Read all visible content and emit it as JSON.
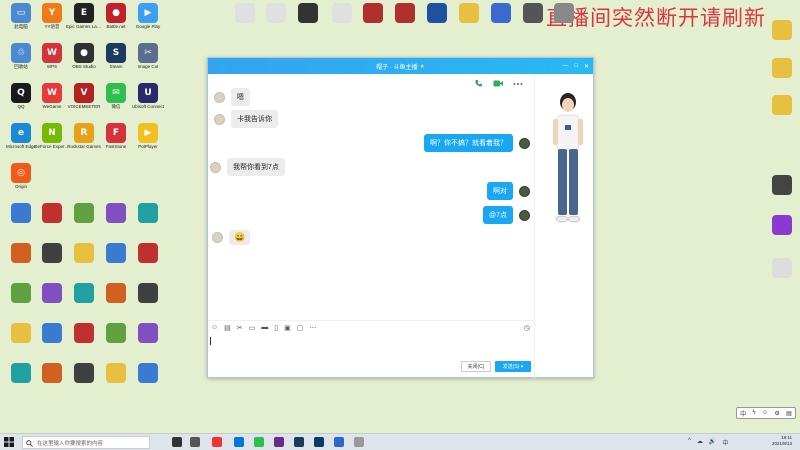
{
  "overlay": {
    "text": "直播间突然断开请刷新"
  },
  "desktop_icons": [
    {
      "label": "此电脑",
      "color": "#4a8ad0",
      "glyph": "▭"
    },
    {
      "label": "YY语音",
      "color": "#f07a1a",
      "glyph": "Y"
    },
    {
      "label": "Epic Games Launcher",
      "color": "#222222",
      "glyph": "E"
    },
    {
      "label": "Battle.net",
      "color": "#c0222a",
      "glyph": "●"
    },
    {
      "label": "Google Play",
      "color": "#3ca0f0",
      "glyph": "▶"
    },
    {
      "label": "回收站",
      "color": "#4a8ad0",
      "glyph": "♲"
    },
    {
      "label": "WPS",
      "color": "#d4333b",
      "glyph": "W"
    },
    {
      "label": "OBS Studio",
      "color": "#303030",
      "glyph": "●"
    },
    {
      "label": "Steam",
      "color": "#1b3c60",
      "glyph": "S"
    },
    {
      "label": "Image Cut",
      "color": "#5a6e90",
      "glyph": "✂"
    },
    {
      "label": "QQ",
      "color": "#1a1a1a",
      "glyph": "Q"
    },
    {
      "label": "WeGame",
      "color": "#e73a3a",
      "glyph": "W"
    },
    {
      "label": "VOICEMEETER",
      "color": "#b22222",
      "glyph": "V"
    },
    {
      "label": "微信",
      "color": "#2fbf4f",
      "glyph": "✉"
    },
    {
      "label": "Ubisoft Connect",
      "color": "#2a2a6a",
      "glyph": "U"
    },
    {
      "label": "Microsoft Edge",
      "color": "#1c8ad0",
      "glyph": "e"
    },
    {
      "label": "GeForce Experience",
      "color": "#76b900",
      "glyph": "N"
    },
    {
      "label": "Rockstar Games",
      "color": "#e7a21a",
      "glyph": "R"
    },
    {
      "label": "FastStone",
      "color": "#d4333b",
      "glyph": "F"
    },
    {
      "label": "PotPlayer",
      "color": "#f0c020",
      "glyph": "▶"
    },
    {
      "label": "Origin",
      "color": "#f05a1a",
      "glyph": "◎"
    }
  ],
  "chat_window": {
    "title": "帽子 · 斗鱼主播",
    "title_star": "★",
    "window_controls": [
      "—",
      "□",
      "✕"
    ],
    "tools": [
      "phone-icon",
      "video-icon",
      "more-icon"
    ],
    "messages": [
      {
        "from": "them",
        "text": "嗯"
      },
      {
        "from": "them",
        "text": "卡我告诉你"
      },
      {
        "from": "me",
        "text": "啊？你不搞？就看着我？"
      },
      {
        "from": "them",
        "text": "我帮你看到7点"
      },
      {
        "from": "me",
        "text": "啊对"
      },
      {
        "from": "me",
        "text": "@7点"
      },
      {
        "from": "them",
        "text": "😄"
      }
    ],
    "toolbar_icons": [
      "☺",
      "▤",
      "✂",
      "▭",
      "▬",
      "▯",
      "▣",
      "▢",
      "⋯"
    ],
    "history_icon": "◷",
    "buttons": {
      "close": "关闭(C)",
      "send": "发送(S)  ▾"
    }
  },
  "ime_bar": {
    "items": [
      "中",
      "ϟ",
      "☺",
      "⚙",
      "▤"
    ]
  },
  "taskbar": {
    "search_placeholder": "在这里输入你要搜索的内容",
    "time": "18:11",
    "date": "2021/8/13",
    "tray_icons": [
      "^",
      "☁",
      "🔊",
      "中"
    ],
    "app_colors": [
      "#e33",
      "#0078d4",
      "#2fbf4f",
      "#6a2a8a",
      "#1b3c60",
      "#0a3a6a",
      "#2a6ad0",
      "#999"
    ]
  }
}
